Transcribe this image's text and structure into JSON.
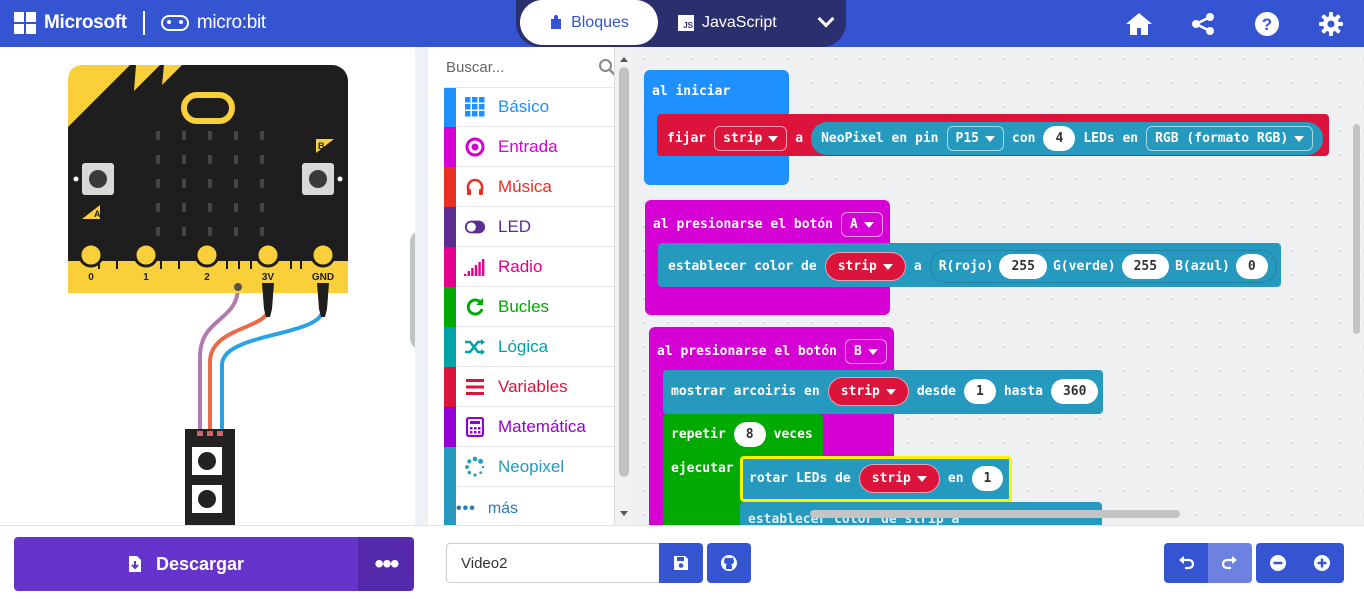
{
  "header": {
    "brand": "Microsoft",
    "product": "micro:bit",
    "modes": {
      "blocks": "Bloques",
      "javascript": "JavaScript",
      "js_badge": "JS"
    },
    "colors": {
      "header_bg": "#3454d1",
      "mode_bg": "#2a2f6e"
    },
    "icons": [
      "home-icon",
      "share-icon",
      "help-icon",
      "settings-icon"
    ]
  },
  "simulator": {
    "button_a": "A",
    "button_b": "B",
    "pins": [
      "0",
      "1",
      "2",
      "3V",
      "GND"
    ],
    "board_color": "#1e1e1e",
    "accent_color": "#f9d03a"
  },
  "toolbox": {
    "search_placeholder": "Buscar...",
    "categories": [
      {
        "label": "Básico",
        "color": "#1e90ff",
        "icon": "grid-icon"
      },
      {
        "label": "Entrada",
        "color": "#d400d4",
        "icon": "target-icon"
      },
      {
        "label": "Música",
        "color": "#e63022",
        "icon": "headphones-icon"
      },
      {
        "label": "LED",
        "color": "#5c2d91",
        "icon": "toggle-icon"
      },
      {
        "label": "Radio",
        "color": "#e3008c",
        "icon": "signal-icon"
      },
      {
        "label": "Bucles",
        "color": "#00aa00",
        "icon": "refresh-icon"
      },
      {
        "label": "Lógica",
        "color": "#00a4a6",
        "icon": "shuffle-icon"
      },
      {
        "label": "Variables",
        "color": "#dc143c",
        "icon": "lines-icon"
      },
      {
        "label": "Matemática",
        "color": "#9400d3",
        "icon": "calculator-icon"
      },
      {
        "label": "Neopixel",
        "color": "#2699bf",
        "icon": "spinner-icon"
      }
    ],
    "more": "más"
  },
  "workspace": {
    "on_start": {
      "hat": "al iniciar",
      "set": "fijar",
      "var": "strip",
      "to": "a",
      "neopixel": "NeoPixel en pin",
      "pin": "P15",
      "with": "con",
      "leds_count": "4",
      "leds_in": "LEDs en",
      "mode": "RGB (formato RGB)"
    },
    "button_a": {
      "hat": "al presionarse el botón",
      "button": "A",
      "set_color": "establecer color de",
      "var": "strip",
      "to": "a",
      "r_label": "R(rojo)",
      "r_value": "255",
      "g_label": "G(verde)",
      "g_value": "255",
      "b_label": "B(azul)",
      "b_value": "0"
    },
    "button_b": {
      "hat": "al presionarse el botón",
      "button": "B",
      "rainbow": "mostrar arcoiris en",
      "var": "strip",
      "from": "desde",
      "from_value": "1",
      "to": "hasta",
      "to_value": "360",
      "repeat": "repetir",
      "times_value": "8",
      "times": "veces",
      "execute": "ejecutar",
      "rotate": "rotar LEDs de",
      "rotate_var": "strip",
      "by": "en",
      "by_value": "1",
      "partial": "establecer color de strip a"
    }
  },
  "bottom": {
    "download": "Descargar",
    "more": "•••",
    "project_name": "Video2"
  }
}
